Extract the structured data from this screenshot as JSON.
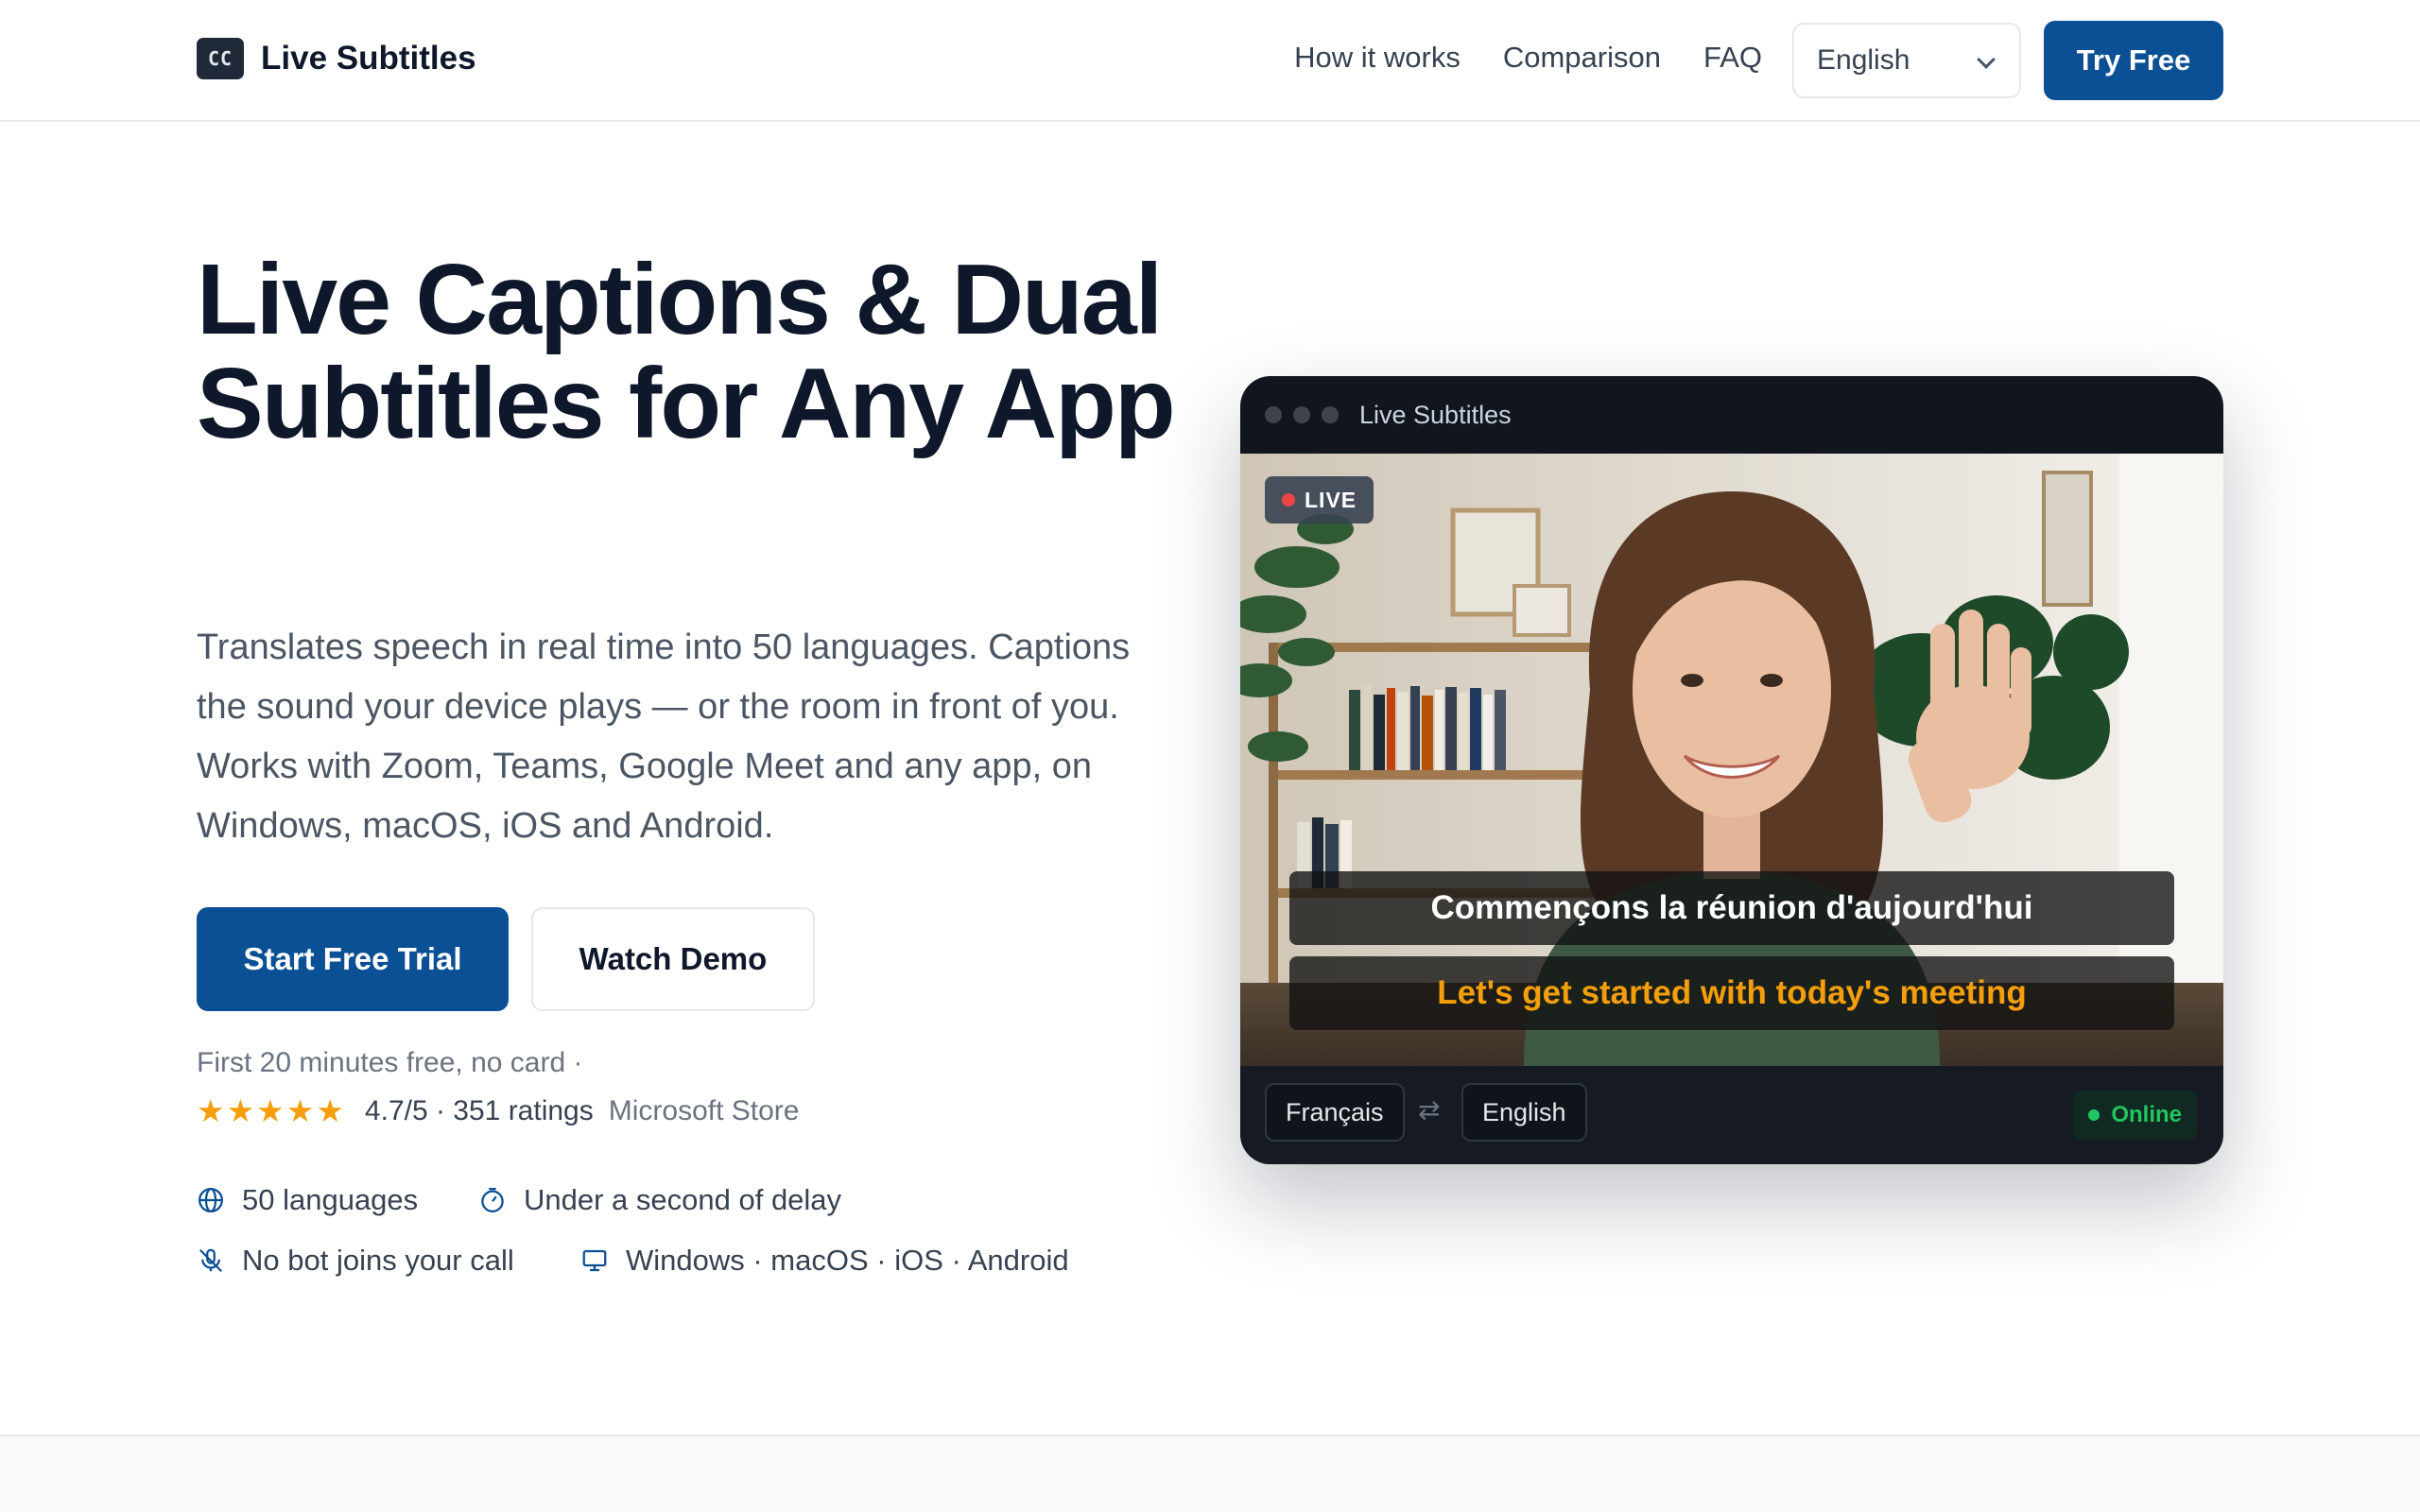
{
  "header": {
    "logo_text": "CC",
    "brand": "Live Subtitles",
    "nav": [
      "How it works",
      "Comparison",
      "FAQ"
    ],
    "language_selected": "English",
    "cta": "Try Free"
  },
  "hero": {
    "title": "Live Captions & Dual Subtitles for Any App",
    "subtitle": "Translates speech in real time into 50 languages. Captions the sound your device plays — or the room in front of you. Works with Zoom, Teams, Google Meet and any app, on Windows, macOS, iOS and Android.",
    "primary_button": "Start Free Trial",
    "secondary_button": "Watch Demo",
    "free_note": "First 20 minutes free, no card  ·",
    "stars": "★★★★★",
    "rating": "4.7/5 · 351 ratings",
    "store": "Microsoft Store",
    "rating_value": 4.7,
    "features": [
      {
        "icon": "globe-icon",
        "label": "50 languages"
      },
      {
        "icon": "timer-icon",
        "label": "Under a second of delay"
      },
      {
        "icon": "no-bot-icon",
        "label": "No bot joins your call"
      },
      {
        "icon": "monitor-icon",
        "label": "Windows · macOS · iOS · Android"
      }
    ]
  },
  "preview": {
    "window_title": "Live Subtitles",
    "live_label": "LIVE",
    "caption_source": "Commençons la réunion d'aujourd'hui",
    "caption_translation": "Let's get started with today's meeting",
    "source_language": "Français",
    "swap_symbol": "⇄",
    "target_language": "English",
    "status": "Online"
  },
  "colors": {
    "primary": "#0b4f94",
    "star": "#f59e0b",
    "caption_translation": "#f59e0b",
    "status_online": "#22c55e",
    "live_dot": "#ef4444"
  }
}
